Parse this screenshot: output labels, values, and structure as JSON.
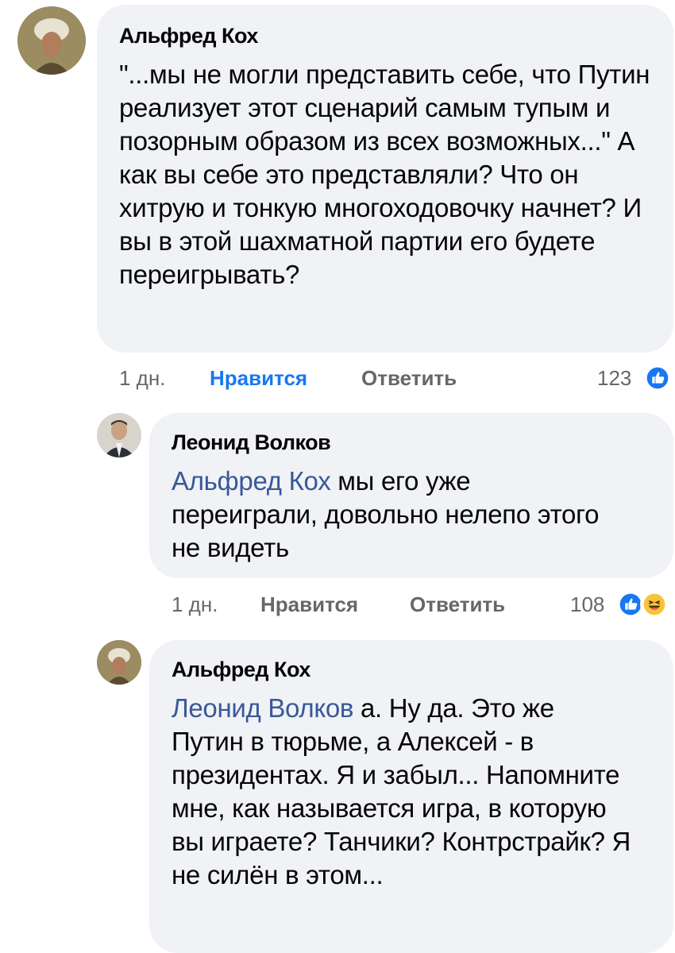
{
  "comments": [
    {
      "author": "Альфред Кох",
      "text": "\"...мы не могли представить себе, что Путин реализует этот сценарий самым тупым и позорным образом из всех возможных...\" А как вы себе это представляли? Что он хитрую и тонкую многоходовочку начнет? И вы в этой шахматной партии его будете переигрывать?",
      "time": "1 дн.",
      "like_label": "Нравится",
      "reply_label": "Ответить",
      "reaction_count": "123",
      "reactions": [
        "like-icon"
      ]
    },
    {
      "author": "Леонид Волков",
      "mention": "Альфред Кох",
      "text": " мы его уже переиграли, довольно нелепо этого не видеть",
      "time": "1 дн.",
      "like_label": "Нравится",
      "reply_label": "Ответить",
      "reaction_count": "108",
      "reactions": [
        "like-icon",
        "haha-icon"
      ]
    },
    {
      "author": "Альфред Кох",
      "mention": "Леонид Волков",
      "text": " а. Ну да. Это же Путин в тюрьме, а Алексей - в президентах. Я и забыл... Напомните мне, как называется игра, в которую вы играете? Танчики? Контрстрайк? Я не силён в этом..."
    }
  ],
  "colors": {
    "bubble": "#f0f2f5",
    "mention": "#385898",
    "like_active": "#1877f2",
    "meta": "#65676b"
  }
}
